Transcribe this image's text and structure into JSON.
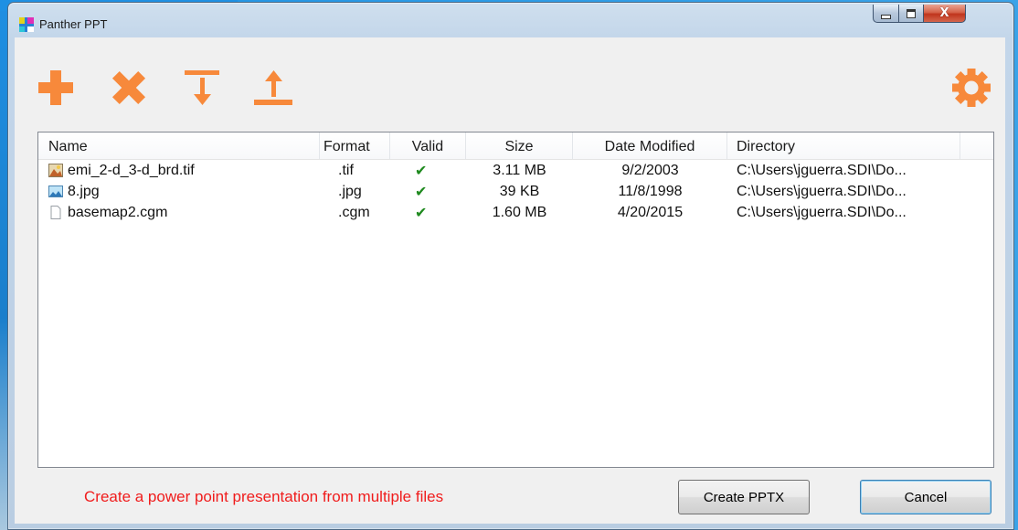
{
  "window": {
    "title": "Panther PPT"
  },
  "toolbar": {
    "add": "add-icon",
    "remove": "remove-icon",
    "move_down": "move-down-icon",
    "move_up": "move-up-icon",
    "settings": "gear-icon",
    "accent_color": "#f7893b"
  },
  "list": {
    "columns": [
      "Name",
      "Format",
      "Valid",
      "Size",
      "Date Modified",
      "Directory"
    ],
    "rows": [
      {
        "name": "emi_2-d_3-d_brd.tif",
        "format": ".tif",
        "valid": "✔",
        "size": "3.11 MB",
        "date": "9/2/2003",
        "directory": "C:\\Users\\jguerra.SDI\\Do...",
        "icon": "tif-image-icon"
      },
      {
        "name": "8.jpg",
        "format": ".jpg",
        "valid": "✔",
        "size": "39 KB",
        "date": "11/8/1998",
        "directory": "C:\\Users\\jguerra.SDI\\Do...",
        "icon": "jpg-image-icon"
      },
      {
        "name": "basemap2.cgm",
        "format": ".cgm",
        "valid": "✔",
        "size": "1.60 MB",
        "date": "4/20/2015",
        "directory": "C:\\Users\\jguerra.SDI\\Do...",
        "icon": "blank-file-icon"
      }
    ]
  },
  "footer": {
    "status": "Create a power point presentation from multiple files",
    "status_color": "#f01c1c",
    "create_label": "Create PPTX",
    "cancel_label": "Cancel"
  }
}
